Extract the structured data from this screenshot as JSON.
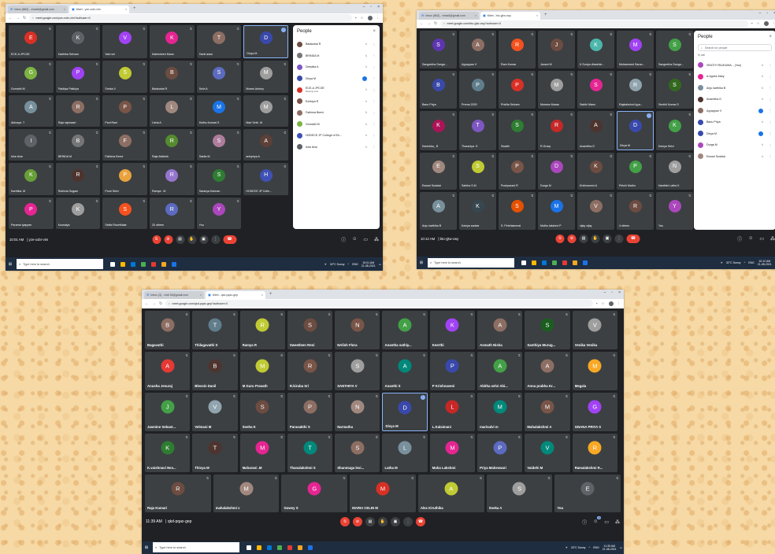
{
  "colors": {
    "meet_bg": "#202124",
    "tile_bg": "#3c4043",
    "end_call": "#ea4335",
    "accent": "#8ab4f8",
    "taskbar": "#1f2d40"
  },
  "screenshots": [
    {
      "tabs": {
        "mail": "Inbox (863) - vimal4@gmail.com",
        "meet": "Meet - yze-xobr-vim"
      },
      "url": "meet.google.com/yze-xobr-vim?authuser=0",
      "tiles": [
        {
          "name": "ECE-A JPCOE",
          "initial": "E",
          "color": "#d93025"
        },
        {
          "name": "Karthika Selvam",
          "initial": "K",
          "color": "#5f6368"
        },
        {
          "name": "Vani vei",
          "initial": "V",
          "color": "#a142f4"
        },
        {
          "name": "Kaliesheeri Mano",
          "initial": "K",
          "color": "#e52592"
        },
        {
          "name": "Tamil arasi",
          "initial": "T",
          "color": "#8d6e63"
        },
        {
          "name": "Divya M",
          "initial": "D",
          "color": "#3949ab",
          "highlight": true
        },
        {
          "name": "Gomathi M",
          "initial": "G",
          "color": "#7cb342"
        },
        {
          "name": "Pakkiya Pakkiya",
          "initial": "P",
          "color": "#a142f4"
        },
        {
          "name": "Sneka.V",
          "initial": "S",
          "color": "#c0ca33"
        },
        {
          "name": "Balakubai R",
          "initial": "B",
          "color": "#6d4c41"
        },
        {
          "name": "Selvi A",
          "initial": "S",
          "color": "#5c6bc0"
        },
        {
          "name": "Moses Antony",
          "initial": "M",
          "color": "#9e9e9e"
        },
        {
          "name": "Abinaya .T",
          "initial": "A",
          "color": "#78909c"
        },
        {
          "name": "Raja rajeswari",
          "initial": "R",
          "color": "#8d6e63"
        },
        {
          "name": "Paul Rani",
          "initial": "P",
          "color": "#795548"
        },
        {
          "name": "Lisha A",
          "initial": "L",
          "color": "#a1887f"
        },
        {
          "name": "Muthu Kumari.S",
          "initial": "M",
          "color": "#1a73e8"
        },
        {
          "name": "Mari Selvi .M",
          "initial": "M",
          "color": "#9e9e9e"
        },
        {
          "name": "Isha Isha",
          "initial": "I",
          "color": "#5f6368"
        },
        {
          "name": "BRINDA M",
          "initial": "B",
          "color": "#757575"
        },
        {
          "name": "Fathima Beevi",
          "initial": "F",
          "color": "#8d6e63"
        },
        {
          "name": "Raja Abishek",
          "initial": "R",
          "color": "#558b2f"
        },
        {
          "name": "Sakila M",
          "initial": "S",
          "color": "#ad7d9c"
        },
        {
          "name": "anispriya A",
          "initial": "A",
          "color": "#5d4037"
        },
        {
          "name": "Karthika. M",
          "initial": "K",
          "color": "#689f38"
        },
        {
          "name": "Ruthicia Sogam",
          "initial": "R",
          "color": "#4e342e"
        },
        {
          "name": "Porul Selvi",
          "initial": "P",
          "color": "#e8a33d"
        },
        {
          "name": "Ramya . M",
          "initial": "R",
          "color": "#9575cd"
        },
        {
          "name": "Saranya Kannan",
          "initial": "S",
          "color": "#2e7d32"
        },
        {
          "name": "HODECE JP Colle...",
          "initial": "H",
          "color": "#3f51b5"
        },
        {
          "name": "Parama Iyappan",
          "initial": "P",
          "color": "#e52592"
        },
        {
          "name": "Kousalya",
          "initial": "K",
          "color": "#9e9e9e"
        },
        {
          "name": "Stella RoseMalar",
          "initial": "S",
          "color": "#f4511e"
        },
        {
          "name": "20 others",
          "initial": "R",
          "color": "#5c6bc0"
        },
        {
          "name": "You",
          "initial": "Y",
          "color": "#ab47bc"
        }
      ],
      "people": {
        "title": "People",
        "rows": [
          {
            "name": "Balakubai R",
            "color": "#6d4c41"
          },
          {
            "name": "BRINDA M",
            "color": "#757575"
          },
          {
            "name": "Deepika A",
            "color": "#7e57c2"
          },
          {
            "name": "Divya M",
            "color": "#3949ab",
            "active": true
          },
          {
            "name": "ECE-A JPCOE",
            "sub": "Meeting host",
            "color": "#d93025"
          },
          {
            "name": "Ezekiya R",
            "color": "#795548"
          },
          {
            "name": "Fathima Beevi",
            "color": "#8d6e63"
          },
          {
            "name": "Gomathi M",
            "color": "#7cb342"
          },
          {
            "name": "HODECE JP College of En...",
            "color": "#3f51b5"
          },
          {
            "name": "Isha Isha",
            "color": "#5f6368"
          }
        ]
      },
      "time": "10:01 AM",
      "code": "yze-xobr-vim",
      "taskbar": {
        "search": "Type here to search",
        "weather": "32°C Sunny",
        "lang": "ENG",
        "clock_time": "10:01 AM",
        "clock_date": "21-08-2021"
      }
    },
    {
      "tabs": {
        "mail": "Inbox (863) - vimal4@gmail.com",
        "meet": "Meet - bto-yjtw-cwy"
      },
      "url": "meet.google.com/bto-yjtw-cwy?authuser=0",
      "tiles": [
        {
          "name": "Sangeetha Sanga...",
          "initial": "S",
          "color": "#5e35b1"
        },
        {
          "name": "Ayyappan V",
          "initial": "A",
          "color": "#8d6e63"
        },
        {
          "name": "Ram Kumar",
          "initial": "R",
          "color": "#f4511e"
        },
        {
          "name": "Janani M",
          "initial": "J",
          "color": "#6d4c41"
        },
        {
          "name": "K.Suriya dharshin...",
          "initial": "K",
          "color": "#4db6ac"
        },
        {
          "name": "Mohammed Saran...",
          "initial": "M",
          "color": "#a142f4"
        },
        {
          "name": "Sangeetha Sanga...",
          "initial": "S",
          "color": "#43a047"
        },
        {
          "name": "Banu Priya",
          "initial": "B",
          "color": "#3949ab"
        },
        {
          "name": "Prema 2020",
          "initial": "P",
          "color": "#607d8b"
        },
        {
          "name": "Prisilla Selvam",
          "initial": "P",
          "color": "#d93025"
        },
        {
          "name": "Muneso Maran",
          "initial": "M",
          "color": "#9e9e9e"
        },
        {
          "name": "Sakthi Mano",
          "initial": "S",
          "color": "#e52592"
        },
        {
          "name": "Rajalakshmi lyya...",
          "initial": "R",
          "color": "#90a4ae"
        },
        {
          "name": "Senthil Kumar.S",
          "initial": "S",
          "color": "#33691e"
        },
        {
          "name": "Kanishka_ B",
          "initial": "K",
          "color": "#ad1457"
        },
        {
          "name": "Tharaniya .S",
          "initial": "T",
          "color": "#7e57c2"
        },
        {
          "name": "Swathi",
          "initial": "S",
          "color": "#2e7d32"
        },
        {
          "name": "R.Gracy",
          "initial": "R",
          "color": "#c62828"
        },
        {
          "name": "Anamitha.G",
          "initial": "A",
          "color": "#4e342e"
        },
        {
          "name": "Divya M",
          "initial": "D",
          "color": "#3949ab",
          "highlight": true
        },
        {
          "name": "Kaviya Selvi",
          "initial": "K",
          "color": "#43a047"
        },
        {
          "name": "Eswari Sudalai",
          "initial": "E",
          "color": "#a1887f"
        },
        {
          "name": "Sabiha S.M",
          "initial": "S",
          "color": "#c0ca33"
        },
        {
          "name": "Pushparani R",
          "initial": "P",
          "color": "#795548"
        },
        {
          "name": "Durga M",
          "initial": "D",
          "color": "#ab47bc"
        },
        {
          "name": "Krishnaveni A",
          "initial": "K",
          "color": "#6d4c41"
        },
        {
          "name": "Petchi Muthu",
          "initial": "P",
          "color": "#43a047"
        },
        {
          "name": "Nanthini Latha K",
          "initial": "N",
          "color": "#9e9e9e"
        },
        {
          "name": "Anju karthika B",
          "initial": "A",
          "color": "#78909c"
        },
        {
          "name": "Kaviya sankar",
          "initial": "K",
          "color": "#37474f"
        },
        {
          "name": "S. Petchiammal",
          "initial": "S",
          "color": "#e65100"
        },
        {
          "name": "Muthu lakshmi P",
          "initial": "M",
          "color": "#1a73e8"
        },
        {
          "name": "vijay vijay",
          "initial": "V",
          "color": "#8d6e63"
        },
        {
          "name": "4 others",
          "initial": "R",
          "color": "#6d4c41"
        },
        {
          "name": "You",
          "initial": "Y",
          "color": "#ab47bc"
        }
      ],
      "people": {
        "title": "People",
        "search": "Search for people",
        "incall": "In call",
        "rows": [
          {
            "name": "VINOTH RAJKUMA... (You)",
            "color": "#ab47bc"
          },
          {
            "name": "A.Agnes Mary",
            "color": "#e52592"
          },
          {
            "name": "Anju karthika B",
            "color": "#78909c"
          },
          {
            "name": "Anamitha.G",
            "color": "#4e342e"
          },
          {
            "name": "Ayyappan V",
            "color": "#8d6e63",
            "active": true
          },
          {
            "name": "Banu Priya",
            "color": "#3949ab"
          },
          {
            "name": "Divya M",
            "color": "#3949ab",
            "active": true
          },
          {
            "name": "Durga M",
            "color": "#ab47bc"
          },
          {
            "name": "Eswari Sudalai",
            "color": "#a1887f"
          }
        ]
      },
      "time": "10:12 AM",
      "code": "bto-yjtw-cwy",
      "taskbar": {
        "search": "Type here to search",
        "weather": "32°C Sunny",
        "lang": "ENG",
        "clock_time": "10:12 AM",
        "clock_date": "21-08-2021"
      }
    },
    {
      "tabs": {
        "mail": "Inbox (3) - vinit 33@gmail.com",
        "meet": "Meet - qkd-pqax-gep"
      },
      "url": "meet.google.com/qkd-pqax-gep?authuser=0",
      "tiles": [
        {
          "name": "Bagavathi",
          "initial": "B",
          "color": "#8d6e63"
        },
        {
          "name": "Thilagavathi S",
          "initial": "T",
          "color": "#607d8b"
        },
        {
          "name": "Ramya R",
          "initial": "R",
          "color": "#c0ca33"
        },
        {
          "name": "Sweetleen Reni",
          "initial": "S",
          "color": "#6d4c41"
        },
        {
          "name": "NAlish Flora",
          "initial": "N",
          "color": "#795548"
        },
        {
          "name": "Anantha sathiy...",
          "initial": "A",
          "color": "#43a047"
        },
        {
          "name": "Keerthi",
          "initial": "K",
          "color": "#a142f4"
        },
        {
          "name": "Asmath Nisha",
          "initial": "A",
          "color": "#8d6e63"
        },
        {
          "name": "Santhiya Murug...",
          "initial": "S",
          "color": "#1b5e20"
        },
        {
          "name": "Venika Venika",
          "initial": "V",
          "color": "#9e9e9e"
        },
        {
          "name": "Anusha Jesuraj",
          "initial": "A",
          "color": "#e53935"
        },
        {
          "name": "Blessin Danil",
          "initial": "B",
          "color": "#4e342e"
        },
        {
          "name": "M Guru Prasath",
          "initial": "M",
          "color": "#c0ca33"
        },
        {
          "name": "R.kiruba Sri",
          "initial": "R",
          "color": "#795548"
        },
        {
          "name": "SANTHIYA V",
          "initial": "S",
          "color": "#9e9e9e"
        },
        {
          "name": "Ananthi S",
          "initial": "A",
          "color": "#00897b"
        },
        {
          "name": "P Krishnaveni",
          "initial": "P",
          "color": "#3949ab"
        },
        {
          "name": "Abitha selvi Abi...",
          "initial": "A",
          "color": "#43a047"
        },
        {
          "name": "Anna prabha Kr...",
          "initial": "A",
          "color": "#8d6e63"
        },
        {
          "name": "Megala",
          "initial": "M",
          "color": "#f9a825"
        },
        {
          "name": "Jasmine Sebast...",
          "initial": "J",
          "color": "#43a047"
        },
        {
          "name": "Velmani M",
          "initial": "V",
          "color": "#90a4ae"
        },
        {
          "name": "Sneha K",
          "initial": "S",
          "color": "#6d4c41"
        },
        {
          "name": "Parasakthi S",
          "initial": "P",
          "color": "#8d6e63"
        },
        {
          "name": "Narmatha",
          "initial": "N",
          "color": "#a1887f"
        },
        {
          "name": "Divya M",
          "initial": "D",
          "color": "#3949ab",
          "highlight": true
        },
        {
          "name": "L.Kalaimani",
          "initial": "L",
          "color": "#c62828"
        },
        {
          "name": "marisalvi m",
          "initial": "M",
          "color": "#00897b"
        },
        {
          "name": "Mahalakshmi A",
          "initial": "M",
          "color": "#795548"
        },
        {
          "name": "GNANA PRIYA S",
          "initial": "G",
          "color": "#a142f4"
        },
        {
          "name": "K.vaishnavi Nes...",
          "initial": "K",
          "color": "#2e7d32"
        },
        {
          "name": "Thivya M",
          "initial": "T",
          "color": "#4e342e"
        },
        {
          "name": "Maharani .M",
          "initial": "M",
          "color": "#e52592"
        },
        {
          "name": "Thanalakshmi S",
          "initial": "T",
          "color": "#00897b"
        },
        {
          "name": "Shanmuga lexi...",
          "initial": "S",
          "color": "#8d6e63"
        },
        {
          "name": "Latha M",
          "initial": "L",
          "color": "#78909c"
        },
        {
          "name": "Maha Lakshmi",
          "initial": "M",
          "color": "#e52592"
        },
        {
          "name": "Priya Maheswari",
          "initial": "P",
          "color": "#5c6bc0"
        },
        {
          "name": "Vaidehi M",
          "initial": "V",
          "color": "#00897b"
        },
        {
          "name": "Ramalakshmi R...",
          "initial": "R",
          "color": "#f9a825"
        }
      ],
      "last_row": [
        {
          "name": "Raja Kumari",
          "initial": "R",
          "color": "#6d4c41"
        },
        {
          "name": "mahalakshmi v",
          "initial": "M",
          "color": "#a1887f"
        },
        {
          "name": "Gowsy S",
          "initial": "G",
          "color": "#e52592"
        },
        {
          "name": "MARIA CELIN M",
          "initial": "M",
          "color": "#d93025"
        },
        {
          "name": "Alex Kiruthika",
          "initial": "A",
          "color": "#c0ca33"
        },
        {
          "name": "Sneka A",
          "initial": "S",
          "color": "#9e9e9e"
        },
        {
          "name": "You",
          "initial": "E",
          "color": "#5f6368"
        }
      ],
      "participants": "47",
      "time": "11:39 AM",
      "code": "qkd-pqax-gep",
      "taskbar": {
        "search": "Type here to search",
        "weather": "33°C Sunny",
        "lang": "ENG",
        "clock_time": "11:39 AM",
        "clock_date": "21-08-2021"
      }
    }
  ]
}
